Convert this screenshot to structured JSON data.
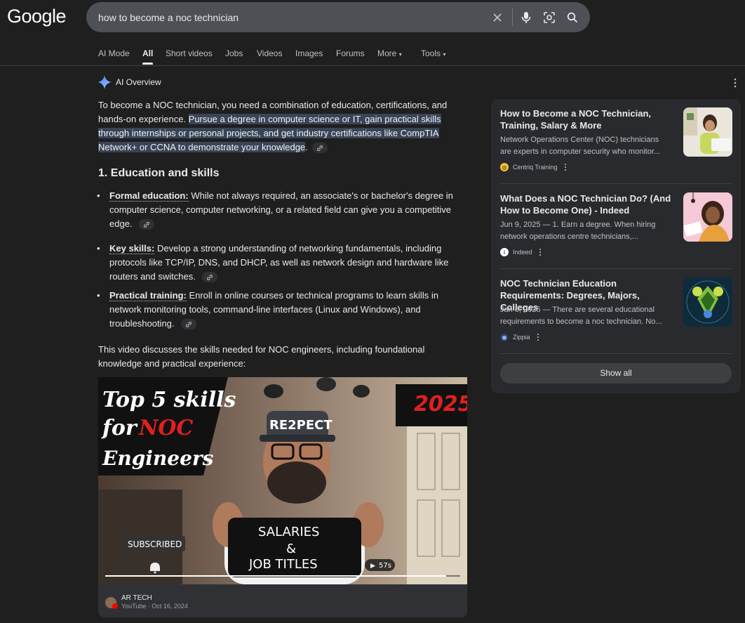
{
  "logo": "Google",
  "search": {
    "value": "how to become a noc technician"
  },
  "tabs": [
    {
      "label": "AI Mode"
    },
    {
      "label": "All"
    },
    {
      "label": "Short videos"
    },
    {
      "label": "Jobs"
    },
    {
      "label": "Videos"
    },
    {
      "label": "Images"
    },
    {
      "label": "Forums"
    },
    {
      "label": "More"
    },
    {
      "label": "Tools"
    }
  ],
  "ai_overview": {
    "label": "AI Overview",
    "intro_plain": "To become a NOC technician, you need a combination of education, certifications, and hands-on experience.",
    "intro_highlight": "Pursue a degree in computer science or IT, gain practical skills through internships or personal projects, and get industry certifications like CompTIA Network+ or CCNA to demonstrate your knowledge",
    "intro_end": ".",
    "heading": "1. Education and skills",
    "bullets": [
      {
        "term": "Formal education:",
        "text": "While not always required, an associate's or bachelor's degree in computer science, computer networking, or a related field can give you a competitive edge."
      },
      {
        "term": "Key skills:",
        "text": "Develop a strong understanding of networking fundamentals, including protocols like TCP/IP, DNS, and DHCP, as well as network design and hardware like routers and switches."
      },
      {
        "term": "Practical training:",
        "text": "Enroll in online courses or technical programs to learn skills in network monitoring tools, command-line interfaces (Linux and Windows), and troubleshooting."
      }
    ],
    "video_intro": "This video discusses the skills needed for NOC engineers, including foundational knowledge and practical experience:",
    "video": {
      "overlay_title_1": "Top 5 skills",
      "overlay_title_2": "for",
      "overlay_title_3": "NOC",
      "overlay_title_4": "Engineers",
      "year": "2025",
      "cap": "RE2PECT",
      "shirt_1": "SALARIES",
      "shirt_2": "&",
      "shirt_3": "JOB  TITLES",
      "subscribed": "SUBSCRIBED",
      "duration": "57s",
      "progress": 0.96,
      "channel": "AR TECH",
      "meta": "YouTube · Oct 16, 2024"
    }
  },
  "sources": [
    {
      "title": "How to Become a NOC Technician, Training, Salary & More",
      "snippet_1": "Network Operations Center (NOC) technicians",
      "snippet_2": "are experts in computer security who monitor...",
      "site": "Centriq Training"
    },
    {
      "title": "What Does a NOC Technician Do? (And How to Become One) - Indeed",
      "snippet_1": "Jun 9, 2025 — 1. Earn a degree. When hiring",
      "snippet_2": "network operations centre technicians,...",
      "site": "Indeed"
    },
    {
      "title": "NOC Technician Education Requirements: Degrees, Majors, Colleges",
      "snippet_1": "Jan 8, 2025 — There are several educational",
      "snippet_2": "requirements to become a noc technician. No...",
      "site": "Zippia"
    }
  ],
  "show_all": "Show all",
  "colors": {
    "bg": "#1f1f1f",
    "panel": "#282a2d",
    "highlight": "#394457",
    "accent": "#8ab4f8"
  }
}
